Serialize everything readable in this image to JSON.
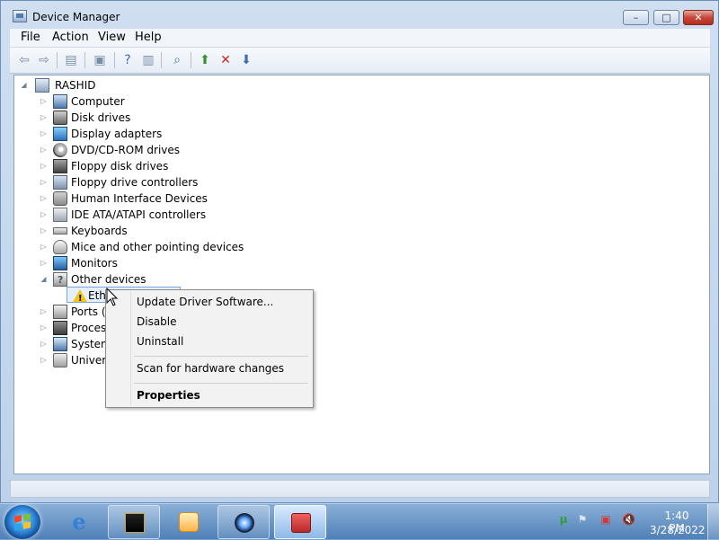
{
  "window": {
    "title": "Device Manager",
    "controls": {
      "minimize": "–",
      "maximize": "□",
      "close": "✕"
    }
  },
  "menubar": {
    "items": [
      "File",
      "Action",
      "View",
      "Help"
    ]
  },
  "toolbar": {
    "icons": [
      "back-arrow-icon",
      "forward-arrow-icon",
      "show-hide-console-tree-icon",
      "properties-icon",
      "help-icon",
      "action-pane-icon",
      "scan-hardware-icon",
      "update-driver-icon",
      "uninstall-device-icon",
      "disable-device-icon"
    ]
  },
  "tree": {
    "root": "RASHID",
    "items": [
      {
        "label": "Computer",
        "icon": "computer-icon"
      },
      {
        "label": "Disk drives",
        "icon": "disk-drive-icon"
      },
      {
        "label": "Display adapters",
        "icon": "display-adapter-icon"
      },
      {
        "label": "DVD/CD-ROM drives",
        "icon": "dvd-drive-icon"
      },
      {
        "label": "Floppy disk drives",
        "icon": "floppy-disk-icon"
      },
      {
        "label": "Floppy drive controllers",
        "icon": "floppy-controller-icon"
      },
      {
        "label": "Human Interface Devices",
        "icon": "hid-icon"
      },
      {
        "label": "IDE ATA/ATAPI controllers",
        "icon": "ide-controller-icon"
      },
      {
        "label": "Keyboards",
        "icon": "keyboard-icon"
      },
      {
        "label": "Mice and other pointing devices",
        "icon": "mouse-icon"
      },
      {
        "label": "Monitors",
        "icon": "monitor-icon"
      },
      {
        "label": "Other devices",
        "icon": "unknown-device-icon"
      },
      {
        "label": "Ethe",
        "icon": "warning-icon"
      },
      {
        "label": "Ports (C",
        "icon": "ports-icon"
      },
      {
        "label": "Process",
        "icon": "processor-icon"
      },
      {
        "label": "System",
        "icon": "system-device-icon"
      },
      {
        "label": "Univers",
        "icon": "usb-controller-icon"
      }
    ]
  },
  "context_menu": {
    "items": [
      "Update Driver Software...",
      "Disable",
      "Uninstall",
      "Scan for hardware changes",
      "Properties"
    ]
  },
  "taskbar": {
    "time": "1:40 PM",
    "date": "3/28/2022",
    "colors": {
      "taskbar": "#4f80b7",
      "warning": "#f0c419",
      "active_task": "#8fb9e6"
    }
  }
}
